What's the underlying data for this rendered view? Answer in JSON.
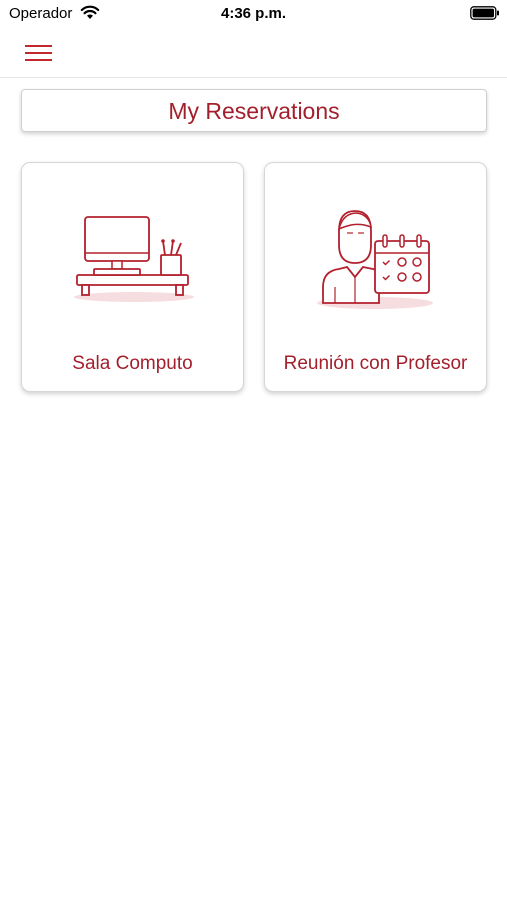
{
  "status_bar": {
    "carrier": "Operador",
    "time": "4:36 p.m.",
    "wifi_icon": "wifi-icon",
    "battery_icon": "battery-icon"
  },
  "nav": {
    "menu_icon": "hamburger-menu-icon"
  },
  "colors": {
    "accent": "#a31f2c"
  },
  "page": {
    "title": "My Reservations"
  },
  "tiles": [
    {
      "label": "Sala Computo",
      "icon": "computer-desk-icon"
    },
    {
      "label": "Reunión con Profesor",
      "icon": "professor-calendar-icon"
    }
  ]
}
